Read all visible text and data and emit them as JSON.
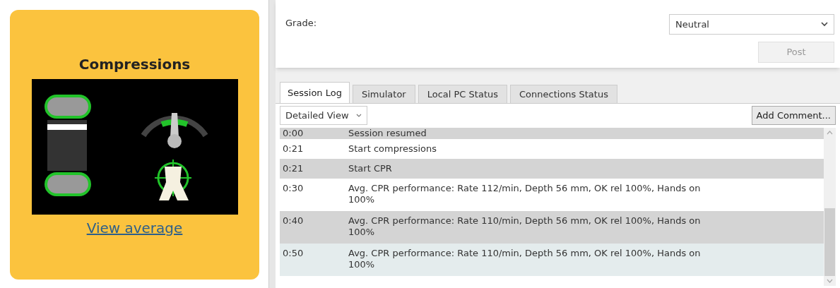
{
  "card": {
    "title": "Compressions",
    "link": "View average"
  },
  "grade": {
    "label": "Grade:",
    "value": "Neutral",
    "post": "Post"
  },
  "tabs": [
    {
      "label": "Session Log",
      "selected": true
    },
    {
      "label": "Simulator",
      "selected": false
    },
    {
      "label": "Local PC Status",
      "selected": false
    },
    {
      "label": "Connections Status",
      "selected": false
    }
  ],
  "toolbar": {
    "view": "Detailed View",
    "add": "Add Comment..."
  },
  "log": [
    {
      "time": "0:00",
      "text": "Session resumed",
      "selected": false
    },
    {
      "time": "0:21",
      "text": "Start compressions",
      "selected": false
    },
    {
      "time": "0:21",
      "text": "Start CPR",
      "selected": false
    },
    {
      "time": "0:30",
      "text": "Avg. CPR performance: Rate 112/min, Depth 56 mm, OK rel 100%, Hands on 100%",
      "selected": false
    },
    {
      "time": "0:40",
      "text": "Avg. CPR performance: Rate 110/min, Depth 56 mm, OK rel 100%, Hands on 100%",
      "selected": false
    },
    {
      "time": "0:50",
      "text": "Avg. CPR performance: Rate 110/min, Depth 56 mm, OK rel 100%, Hands on 100%",
      "selected": true
    }
  ]
}
